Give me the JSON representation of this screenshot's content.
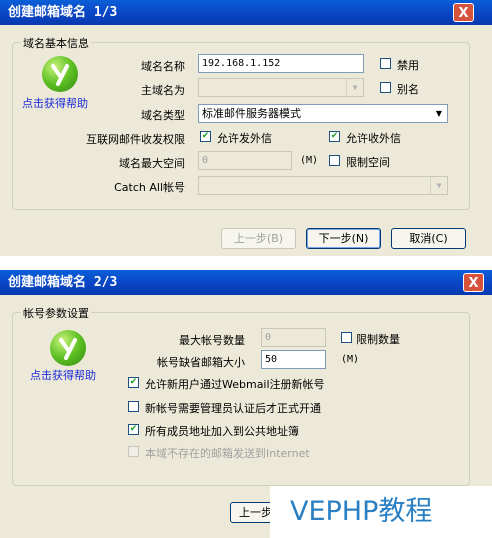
{
  "dialog1": {
    "title": "创建邮箱域名 1/3",
    "close_glyph": "X",
    "group_title": "域名基本信息",
    "help_link": "点击获得帮助",
    "domain_name_label": "域名名称",
    "domain_name_value": "192.168.1.152",
    "disable_label": "禁用",
    "primary_domain_label": "主域名为",
    "alias_label": "别名",
    "domain_type_label": "域名类型",
    "domain_type_value": "标准邮件服务器模式",
    "internet_perm_label": "互联网邮件收发权限",
    "allow_send_label": "允许发外信",
    "allow_receive_label": "允许收外信",
    "max_space_label": "域名最大空间",
    "max_space_value": "0",
    "unit_m": "(M)",
    "limit_space_label": "限制空间",
    "catch_all_label": "Catch All帐号",
    "btn_prev": "上一步(B)",
    "btn_next": "下一步(N)",
    "btn_cancel": "取消(C)"
  },
  "dialog2": {
    "title": "创建邮箱域名 2/3",
    "close_glyph": "X",
    "group_title": "帐号参数设置",
    "help_link": "点击获得帮助",
    "max_accounts_label": "最大帐号数量",
    "max_accounts_value": "0",
    "limit_count_label": "限制数量",
    "default_size_label": "帐号缺省邮箱大小",
    "default_size_value": "50",
    "unit_m": "(M)",
    "opt_webmail_register": "允许新用户通过Webmail注册新帐号",
    "opt_admin_approve": "新帐号需要管理员认证后才正式开通",
    "opt_public_addrbook": "所有成员地址加入到公共地址簿",
    "opt_forward_internet": "本域不存在的邮箱发送到Internet",
    "btn_prev_partial": "上一步"
  },
  "watermark": "VEPHP教程"
}
